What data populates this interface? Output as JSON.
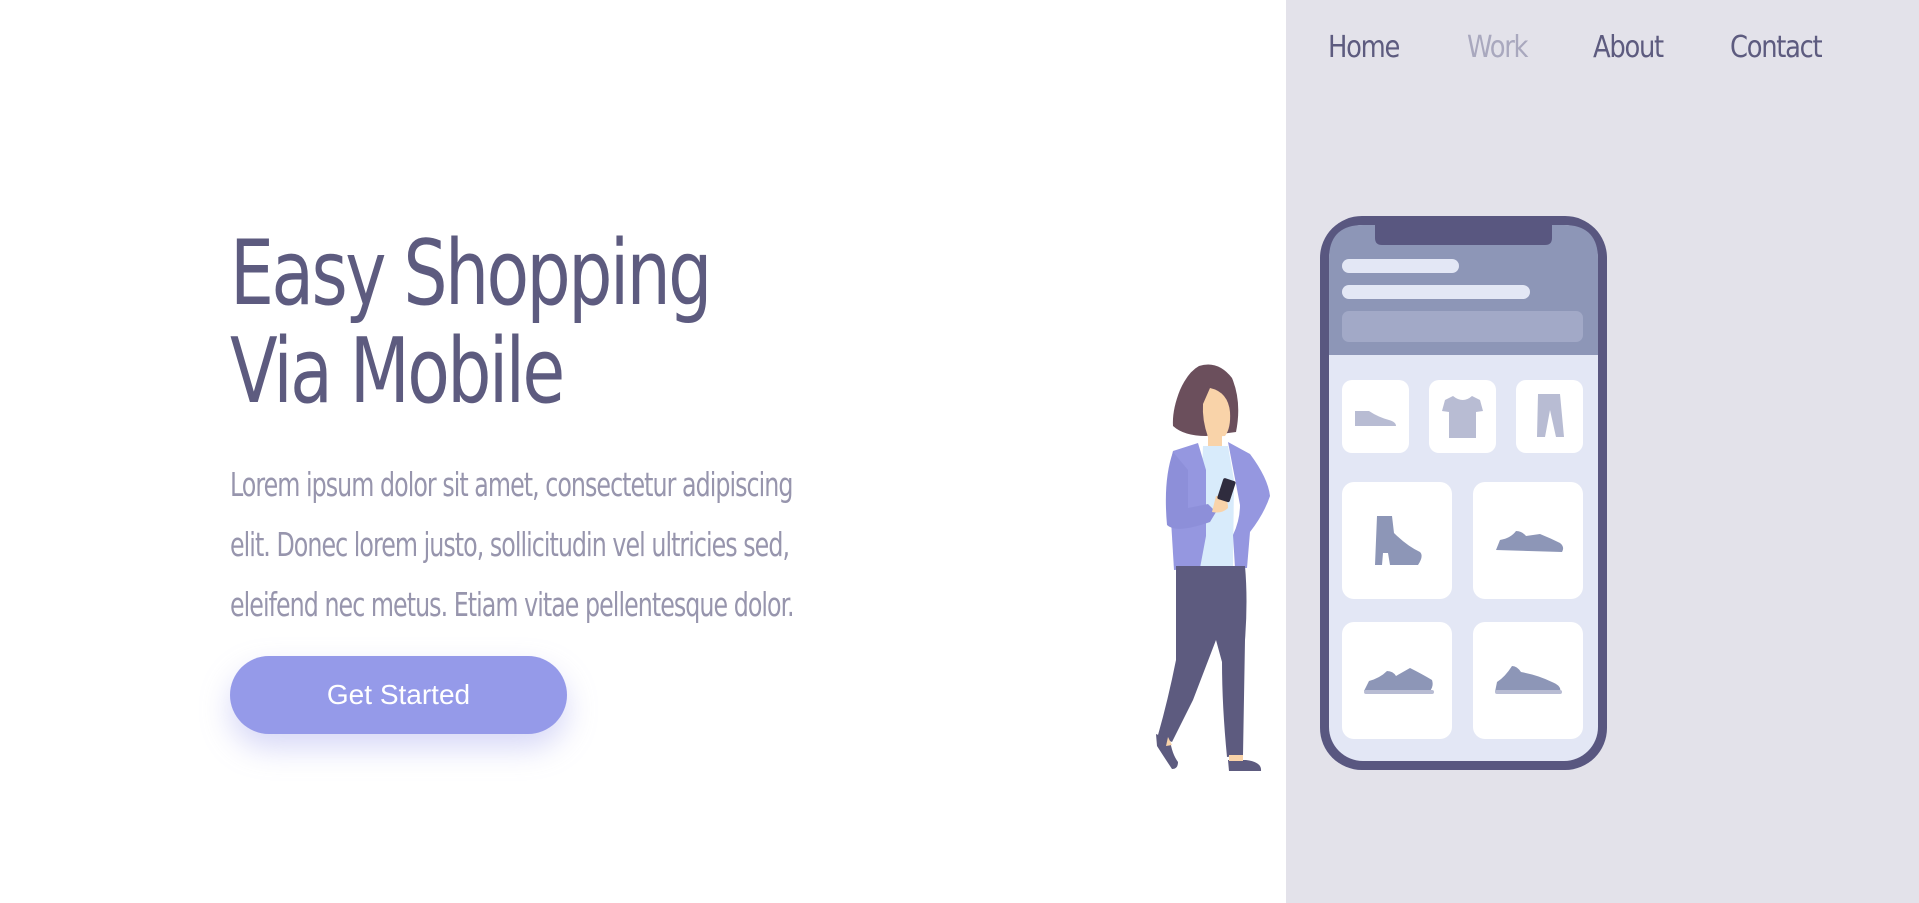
{
  "nav": {
    "items": [
      {
        "label": "Home",
        "active": false
      },
      {
        "label": "Work",
        "active": true
      },
      {
        "label": "About",
        "active": false
      },
      {
        "label": "Contact",
        "active": false
      }
    ]
  },
  "hero": {
    "title_line1": "Easy Shopping",
    "title_line2": "Via Mobile",
    "description_line1": "Lorem ipsum dolor sit amet, consectetur adipiscing",
    "description_line2": "elit. Donec lorem justo, sollicitudin vel ultricies sed,",
    "description_line3": "eleifend nec metus. Etiam vitae pellentesque dolor.",
    "cta_label": "Get Started"
  },
  "icons": {
    "phone": "smartphone-icon",
    "person": "woman-with-phone-illustration",
    "products": [
      "flat-shoe-icon",
      "t-shirt-icon",
      "pants-icon",
      "ankle-boot-icon",
      "sneaker-icon",
      "sneaker-icon",
      "sneaker-icon"
    ]
  },
  "colors": {
    "title": "#5d5b7f",
    "text": "#9795ad",
    "nav": "#5d5b7f",
    "nav_active": "#a9a8be",
    "cta": "#959ae9",
    "panel": "#e3e2ea",
    "phone_frame": "#595780",
    "phone_header": "#8d96b7",
    "phone_body": "#e3e7f5",
    "product_icon": "#8d96b7"
  }
}
